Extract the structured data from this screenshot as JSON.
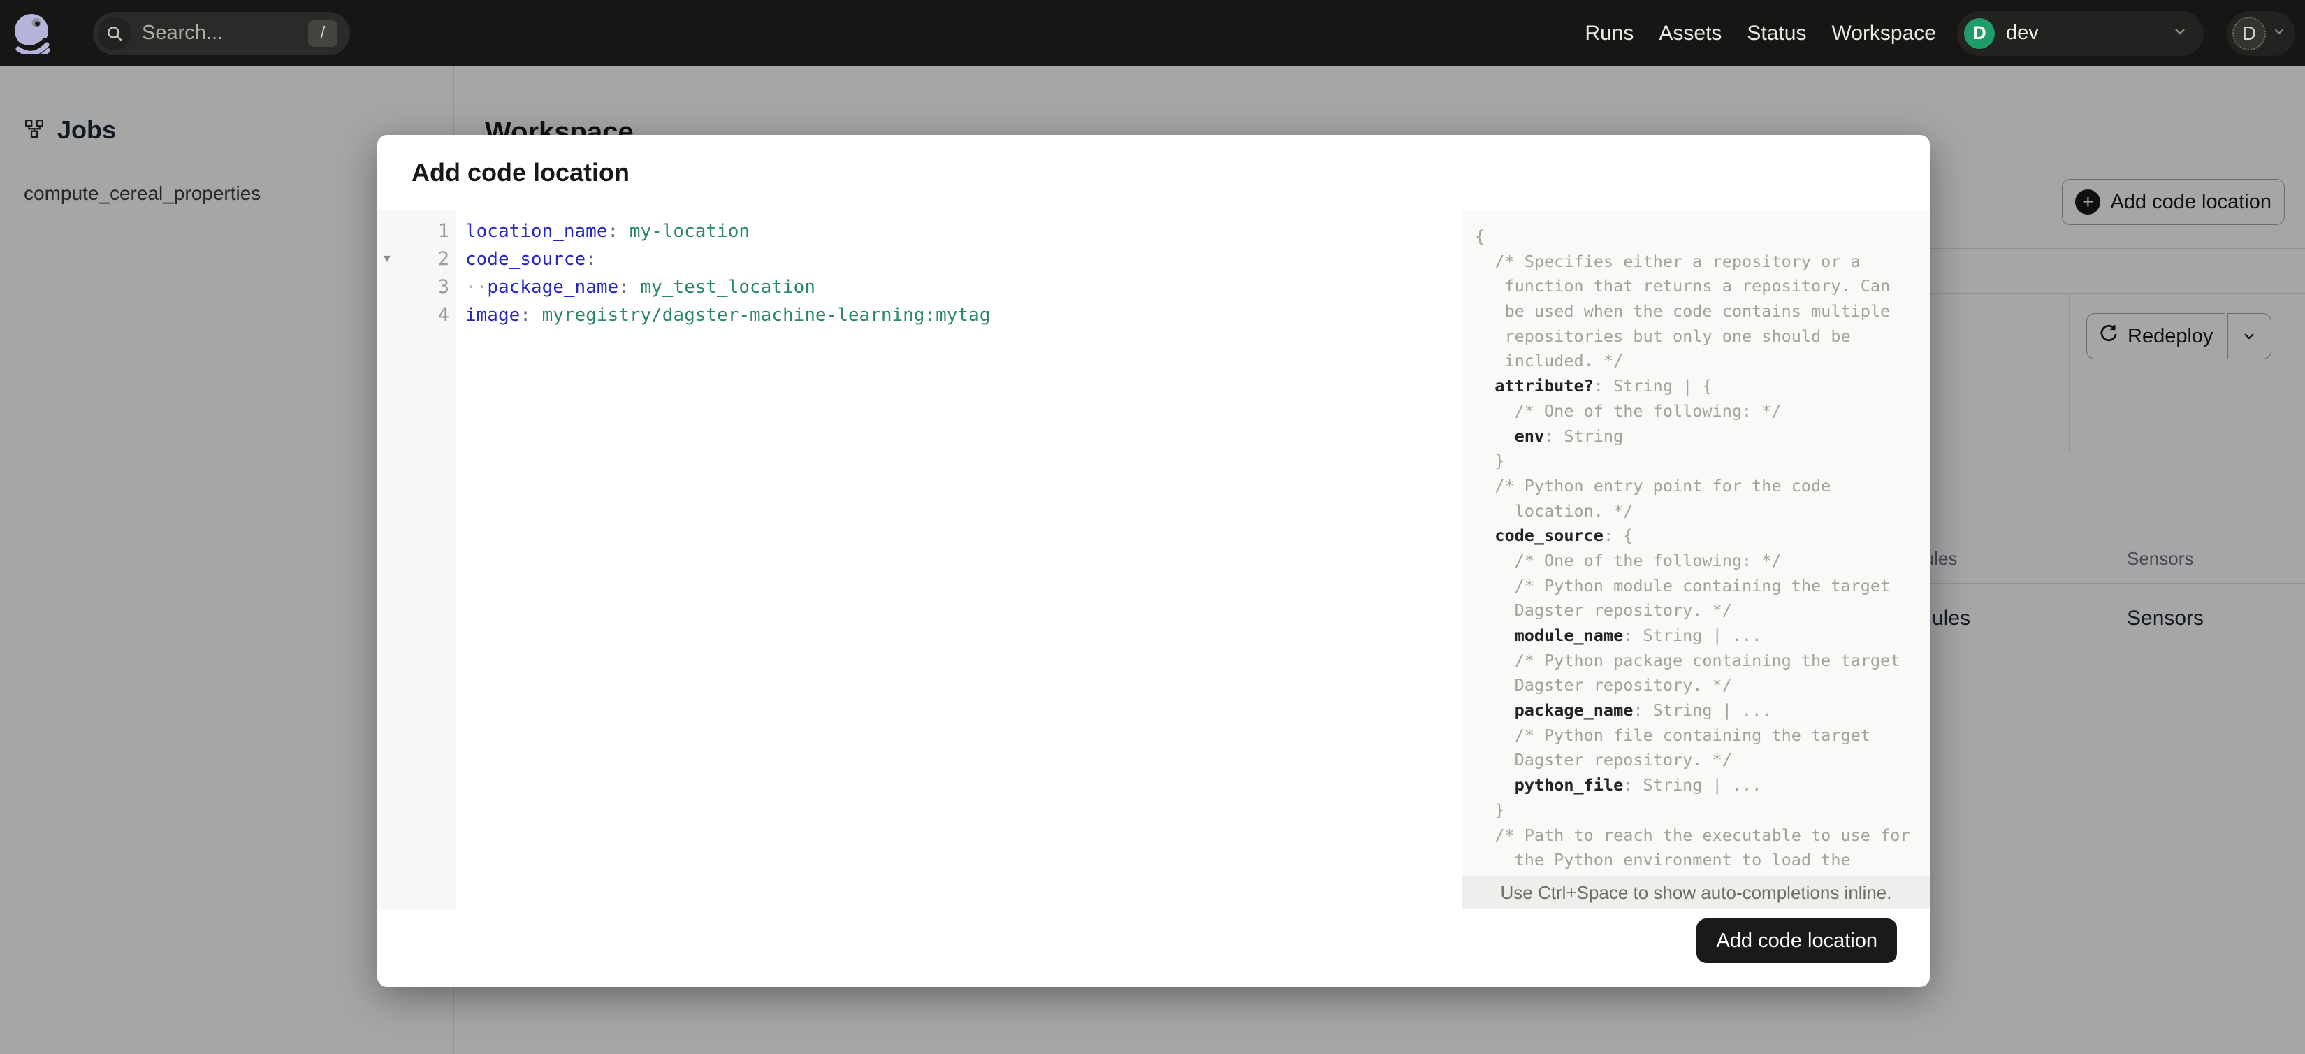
{
  "navbar": {
    "search": {
      "placeholder": "Search...",
      "shortcut": "/"
    },
    "links": [
      "Runs",
      "Assets",
      "Status",
      "Workspace"
    ],
    "deployment": {
      "initial": "D",
      "name": "dev"
    },
    "user": {
      "initial": "D"
    }
  },
  "sidebar": {
    "section_title": "Jobs",
    "items": [
      "compute_cereal_properties"
    ]
  },
  "workspace": {
    "title": "Workspace",
    "add_button_label": "Add code location",
    "redeploy_label": "Redeploy",
    "table_header": [
      "Schedules",
      "Sensors"
    ],
    "table_row": [
      "Schedules",
      "Sensors"
    ]
  },
  "modal": {
    "title": "Add code location",
    "submit_label": "Add code location",
    "hint": "Use Ctrl+Space to show auto-completions inline.",
    "fold_icon": "▼",
    "editor_lines": [
      {
        "num": 1,
        "fold": false,
        "segments": [
          {
            "t": "location_name",
            "c": "key"
          },
          {
            "t": ": ",
            "c": "colon"
          },
          {
            "t": "my-location",
            "c": "value"
          }
        ]
      },
      {
        "num": 2,
        "fold": true,
        "segments": [
          {
            "t": "code_source",
            "c": "key"
          },
          {
            "t": ":",
            "c": "colon"
          }
        ]
      },
      {
        "num": 3,
        "fold": false,
        "segments": [
          {
            "t": "··",
            "c": "indent"
          },
          {
            "t": "package_name",
            "c": "key"
          },
          {
            "t": ": ",
            "c": "colon"
          },
          {
            "t": "my_test_location",
            "c": "value"
          }
        ]
      },
      {
        "num": 4,
        "fold": false,
        "segments": [
          {
            "t": "image",
            "c": "key"
          },
          {
            "t": ": ",
            "c": "colon"
          },
          {
            "t": "myregistry/dagster-machine-learning:mytag",
            "c": "value"
          }
        ]
      }
    ],
    "schema_lines": [
      [
        {
          "t": "{",
          "c": "b"
        }
      ],
      [
        {
          "t": "  ",
          "c": "p"
        },
        {
          "t": "/* Specifies either a repository or a",
          "c": "cm"
        }
      ],
      [
        {
          "t": "   function that returns a repository. Can",
          "c": "cm"
        }
      ],
      [
        {
          "t": "   be used when the code contains multiple",
          "c": "cm"
        }
      ],
      [
        {
          "t": "   repositories but only one should be",
          "c": "cm"
        }
      ],
      [
        {
          "t": "   included. */",
          "c": "cm"
        }
      ],
      [
        {
          "t": "  ",
          "c": "p"
        },
        {
          "t": "attribute?",
          "c": "k"
        },
        {
          "t": ": ",
          "c": "p"
        },
        {
          "t": "String | {",
          "c": "t"
        }
      ],
      [
        {
          "t": "    /* One of the following: */",
          "c": "cm"
        }
      ],
      [
        {
          "t": "    ",
          "c": "p"
        },
        {
          "t": "env",
          "c": "k"
        },
        {
          "t": ": ",
          "c": "p"
        },
        {
          "t": "String",
          "c": "t"
        }
      ],
      [
        {
          "t": "  }",
          "c": "b"
        }
      ],
      [
        {
          "t": "  /* Python entry point for the code",
          "c": "cm"
        }
      ],
      [
        {
          "t": "    location. */",
          "c": "cm"
        }
      ],
      [
        {
          "t": "  ",
          "c": "p"
        },
        {
          "t": "code_source",
          "c": "k"
        },
        {
          "t": ": ",
          "c": "p"
        },
        {
          "t": "{",
          "c": "b"
        }
      ],
      [
        {
          "t": "    /* One of the following: */",
          "c": "cm"
        }
      ],
      [
        {
          "t": "    /* Python module containing the target",
          "c": "cm"
        }
      ],
      [
        {
          "t": "    Dagster repository. */",
          "c": "cm"
        }
      ],
      [
        {
          "t": "    ",
          "c": "p"
        },
        {
          "t": "module_name",
          "c": "k"
        },
        {
          "t": ": ",
          "c": "p"
        },
        {
          "t": "String | ...",
          "c": "t"
        }
      ],
      [
        {
          "t": "    /* Python package containing the target",
          "c": "cm"
        }
      ],
      [
        {
          "t": "    Dagster repository. */",
          "c": "cm"
        }
      ],
      [
        {
          "t": "    ",
          "c": "p"
        },
        {
          "t": "package_name",
          "c": "k"
        },
        {
          "t": ": ",
          "c": "p"
        },
        {
          "t": "String | ...",
          "c": "t"
        }
      ],
      [
        {
          "t": "    /* Python file containing the target",
          "c": "cm"
        }
      ],
      [
        {
          "t": "    Dagster repository. */",
          "c": "cm"
        }
      ],
      [
        {
          "t": "    ",
          "c": "p"
        },
        {
          "t": "python_file",
          "c": "k"
        },
        {
          "t": ": ",
          "c": "p"
        },
        {
          "t": "String | ...",
          "c": "t"
        }
      ],
      [
        {
          "t": "  }",
          "c": "b"
        }
      ],
      [
        {
          "t": "  /* Path to reach the executable to use for",
          "c": "cm"
        }
      ],
      [
        {
          "t": "    the Python environment to load the",
          "c": "cm"
        }
      ]
    ]
  },
  "colors": {
    "brand_purple": "#b4b3d9",
    "deployment_green": "#1f9d68",
    "code_key_blue": "#2527c6",
    "code_value_green": "#2b8a63",
    "navbar_bg": "#171614"
  }
}
